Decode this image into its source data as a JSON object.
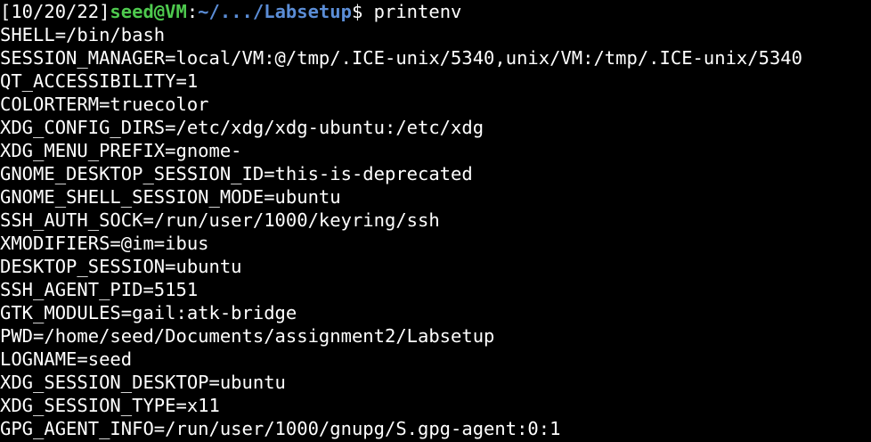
{
  "prompt": {
    "date": "[10/20/22]",
    "user_host": "seed@VM",
    "colon": ":",
    "path": "~/.../Labsetup",
    "dollar": "$ ",
    "command": "printenv"
  },
  "colors": {
    "background": "#000000",
    "text": "#ffffff",
    "user_host": "#4ec94e",
    "path": "#5b8dd6"
  },
  "output_lines": [
    "SHELL=/bin/bash",
    "SESSION_MANAGER=local/VM:@/tmp/.ICE-unix/5340,unix/VM:/tmp/.ICE-unix/5340",
    "QT_ACCESSIBILITY=1",
    "COLORTERM=truecolor",
    "XDG_CONFIG_DIRS=/etc/xdg/xdg-ubuntu:/etc/xdg",
    "XDG_MENU_PREFIX=gnome-",
    "GNOME_DESKTOP_SESSION_ID=this-is-deprecated",
    "GNOME_SHELL_SESSION_MODE=ubuntu",
    "SSH_AUTH_SOCK=/run/user/1000/keyring/ssh",
    "XMODIFIERS=@im=ibus",
    "DESKTOP_SESSION=ubuntu",
    "SSH_AGENT_PID=5151",
    "GTK_MODULES=gail:atk-bridge",
    "PWD=/home/seed/Documents/assignment2/Labsetup",
    "LOGNAME=seed",
    "XDG_SESSION_DESKTOP=ubuntu",
    "XDG_SESSION_TYPE=x11",
    "GPG_AGENT_INFO=/run/user/1000/gnupg/S.gpg-agent:0:1"
  ]
}
